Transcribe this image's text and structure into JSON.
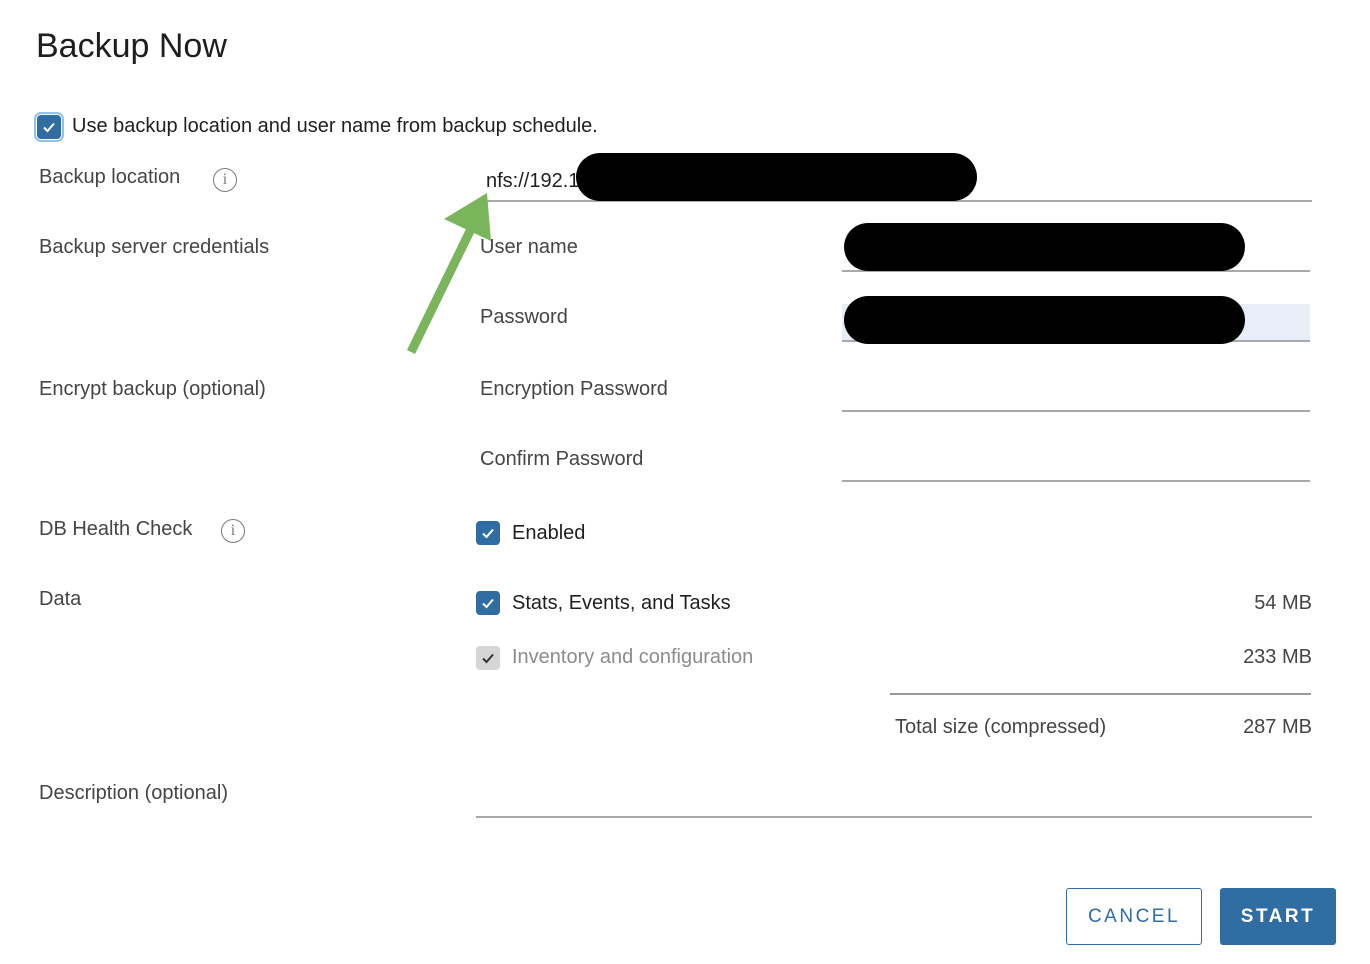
{
  "dialog": {
    "title": "Backup Now"
  },
  "use_schedule": {
    "label": "Use backup location and user name from backup schedule.",
    "checked": true
  },
  "backup_location": {
    "label": "Backup location",
    "value": "nfs://192.1",
    "info_icon": "info-icon"
  },
  "credentials": {
    "label": "Backup server credentials",
    "username_label": "User name",
    "password_label": "Password"
  },
  "encrypt": {
    "label": "Encrypt backup (optional)",
    "password_label": "Encryption Password",
    "confirm_label": "Confirm Password"
  },
  "db_health": {
    "label": "DB Health Check",
    "option_label": "Enabled",
    "checked": true
  },
  "data": {
    "label": "Data",
    "items": [
      {
        "label": "Stats, Events, and Tasks",
        "size": "54 MB",
        "checked": true,
        "disabled": false
      },
      {
        "label": "Inventory and configuration",
        "size": "233 MB",
        "checked": true,
        "disabled": true
      }
    ],
    "total_label": "Total size (compressed)",
    "total_size": "287 MB"
  },
  "description": {
    "label": "Description (optional)",
    "value": ""
  },
  "actions": {
    "cancel_label": "CANCEL",
    "start_label": "START"
  },
  "colors": {
    "accent": "#2f6da3",
    "annotation_arrow": "#7ab55c",
    "redaction": "#000000"
  }
}
